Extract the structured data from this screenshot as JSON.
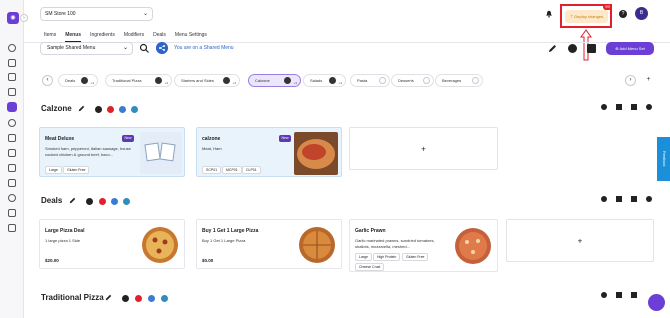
{
  "topbar": {
    "store": "SM Store 100",
    "deploy_label": "Deploy changes",
    "deploy_count": "99",
    "avatar_initial": "B"
  },
  "tabs": [
    "Items",
    "Menus",
    "Ingredients",
    "Modifiers",
    "Deals",
    "Menu Settings"
  ],
  "active_tab": "Menus",
  "menu_bar": {
    "menu_name": "Sample Shared Menu",
    "shared_notice": "You are on a Shared Menu",
    "add_menu_set": "Add Menu Set"
  },
  "categories": [
    {
      "label": "Deals",
      "count": "+3"
    },
    {
      "label": "Traditional Pizza",
      "count": "+3"
    },
    {
      "label": "Starters and Sides",
      "count": "+3"
    },
    {
      "label": "Calzone",
      "count": "+3"
    },
    {
      "label": "Salads",
      "count": "+3"
    },
    {
      "label": "Pasta",
      "count": ""
    },
    {
      "label": "Desserts",
      "count": ""
    },
    {
      "label": "Beverages",
      "count": ""
    }
  ],
  "active_category": "Calzone",
  "sections": {
    "calzone": {
      "title": "Calzone",
      "items": [
        {
          "name": "Meat Deluxe",
          "badge": "New",
          "description": "Smoked ham, pepperoni, Italian sausage, house cooked chicken & ground beef, baco...",
          "tags": [
            "Large",
            "Gluten Free"
          ]
        },
        {
          "name": "calzone",
          "badge": "New",
          "description": "Meat, Ham",
          "tags": [
            "SCP01",
            "MCP01",
            "CLP01"
          ]
        }
      ]
    },
    "deals": {
      "title": "Deals",
      "items": [
        {
          "name": "Large Pizza Deal",
          "description": "1 large pizza 1 Side",
          "price": "$20.00"
        },
        {
          "name": "Buy 1 Get 1 Large Pizza",
          "description": "Buy 1 Get 1 Large Pizza",
          "price": "$0.00"
        },
        {
          "name": "Garlic Prawn",
          "description": "Garlic marinated prawns, sundried tomatoes, shallots, mozzarella, meshed...",
          "tags": [
            "Large",
            "High Protein",
            "Gluten Free",
            "Cheese Crust"
          ]
        }
      ]
    },
    "traditional": {
      "title": "Traditional Pizza"
    }
  },
  "feedback_label": "Feedback",
  "colors": {
    "accent": "#6b3fd6",
    "deploy_bg": "#fde9c9",
    "highlight": "#e0202a",
    "shared_blue": "#2f64c8"
  }
}
